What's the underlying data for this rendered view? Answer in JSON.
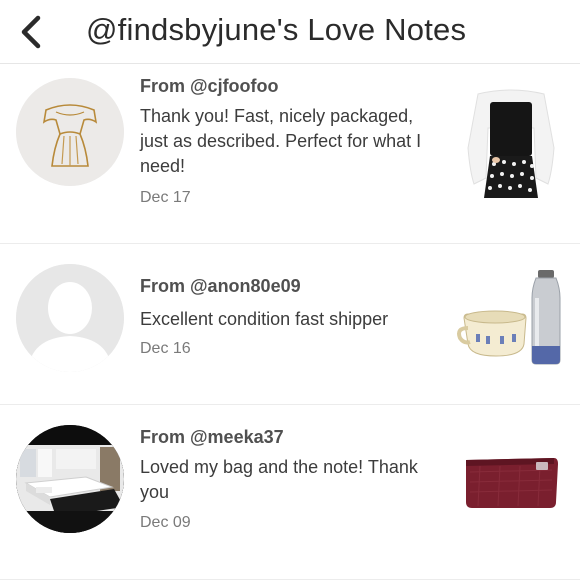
{
  "header": {
    "back_icon": "chevron-left-icon",
    "title": "@findsbyjune's Love Notes"
  },
  "notes": [
    {
      "from": "From @cjfoofoo",
      "message": "Thank you! Fast, nicely packaged, just as described. Perfect for what I need!",
      "date": "Dec 17"
    },
    {
      "from": "From @anon80e09",
      "message": "Excellent condition fast shipper",
      "date": "Dec 16"
    },
    {
      "from": "From @meeka37",
      "message": "Loved my bag and the note! Thank you",
      "date": "Dec 09"
    }
  ]
}
